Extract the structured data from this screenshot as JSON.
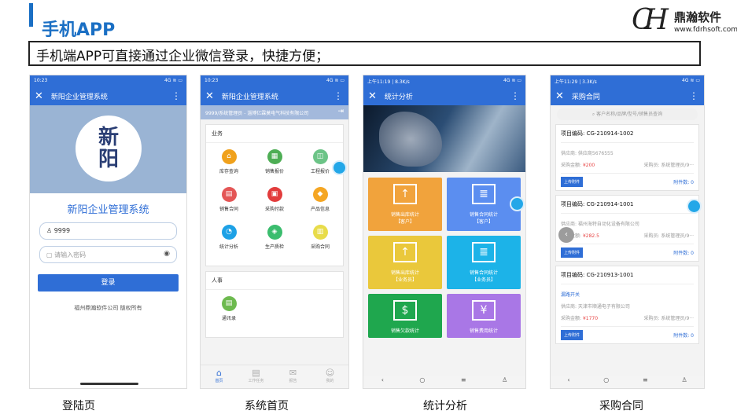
{
  "title": "手机APP",
  "logo": {
    "brand": "鼎瀚软件",
    "url": "www.fdrhsoft.com",
    "mark": "CH"
  },
  "headline": "手机端APP可直接通过企业微信登录，快捷方便；",
  "status": {
    "t1": "10:23",
    "t2": "10:23",
    "t3": "上午11:19 | 8.3K/s",
    "t4": "上午11:29 | 3.3K/s",
    "icons": "4G ≋ ▭"
  },
  "captions": [
    "登陆页",
    "系统首页",
    "统计分析",
    "采购合同"
  ],
  "login": {
    "topbar": "新阳企业管理系统",
    "logo_top": "新",
    "logo_bottom": "阳",
    "app_name": "新阳企业管理系统",
    "username": "9999",
    "pw_placeholder": "请输入密码",
    "button": "登录",
    "copyright": "福州鼎瀚软件公司 版权所有"
  },
  "home": {
    "topbar": "新阳企业管理系统",
    "userbar": "9999/系统管理员 - 淄博亿霖莫电气科技有限公司",
    "sec1": "业务",
    "sec2": "人事",
    "items": [
      {
        "label": "库存查询",
        "color": "#f0a11c",
        "glyph": "⌂"
      },
      {
        "label": "销售报价",
        "color": "#4eae55",
        "glyph": "▦"
      },
      {
        "label": "工程报价",
        "color": "#6cc487",
        "glyph": "◫"
      },
      {
        "label": "销售合同",
        "color": "#e45656",
        "glyph": "▤"
      },
      {
        "label": "采购付款",
        "color": "#e23c3c",
        "glyph": "▣"
      },
      {
        "label": "产品信息",
        "color": "#f5a623",
        "glyph": "◆"
      },
      {
        "label": "统计分析",
        "color": "#1da1e6",
        "glyph": "◔"
      },
      {
        "label": "生产质检",
        "color": "#3bbd6e",
        "glyph": "◈"
      },
      {
        "label": "采购合同",
        "color": "#e8dc4a",
        "glyph": "▥"
      }
    ],
    "contacts": {
      "label": "通讯录",
      "color": "#6dba4f",
      "glyph": "▤"
    },
    "tabs": [
      "首页",
      "工作任务",
      "报告",
      "我的"
    ]
  },
  "stats": {
    "topbar": "统计分析",
    "tiles": [
      {
        "l1": "销售出库统计",
        "l2": "【客户】",
        "color": "#f1a33c",
        "glyph": "↑"
      },
      {
        "l1": "销售合同统计",
        "l2": "【客户】",
        "color": "#5b8ef0",
        "glyph": "≣"
      },
      {
        "l1": "销售出库统计",
        "l2": "【业务员】",
        "color": "#eac83b",
        "glyph": "↑"
      },
      {
        "l1": "销售合同统计",
        "l2": "【业务员】",
        "color": "#1cb3e8",
        "glyph": "≣"
      },
      {
        "l1": "销售欠款统计",
        "l2": "",
        "color": "#1fa74e",
        "glyph": "$"
      },
      {
        "l1": "销售费用统计",
        "l2": "",
        "color": "#a977e6",
        "glyph": "¥"
      }
    ],
    "nav": [
      "‹",
      "○",
      "≡",
      "♙"
    ]
  },
  "purchase": {
    "topbar": "采购合同",
    "search": "客户名称/品牌/型号/销售员查询",
    "records": [
      {
        "code": "项目编码: CG-210914-1002",
        "link": "",
        "supplier": "供应商: 供应商5676555",
        "amount_label": "采购金额: ",
        "amount": "¥200",
        "buyer": "采购员: 系统管理员/9···",
        "upload": "上传附件",
        "attach": "附件数: 0"
      },
      {
        "code": "项目编码: CG-210914-1001",
        "link": "",
        "supplier": "供应商: 福州海特自动化设备有限公司",
        "amount_label": "采购金额: ",
        "amount": "¥282.5",
        "buyer": "采购员: 系统管理员/9···",
        "upload": "上传附件",
        "attach": "附件数: 0"
      },
      {
        "code": "项目编码: CG-210913-1001",
        "link": "漏路开关",
        "supplier": "供应商: 天津市顺通电子有限公司",
        "amount_label": "采购金额: ",
        "amount": "¥1770",
        "buyer": "采购员: 系统管理员/9···",
        "upload": "上传附件",
        "attach": "附件数: 0"
      }
    ],
    "nav": [
      "‹",
      "○",
      "≡",
      "♙"
    ]
  }
}
